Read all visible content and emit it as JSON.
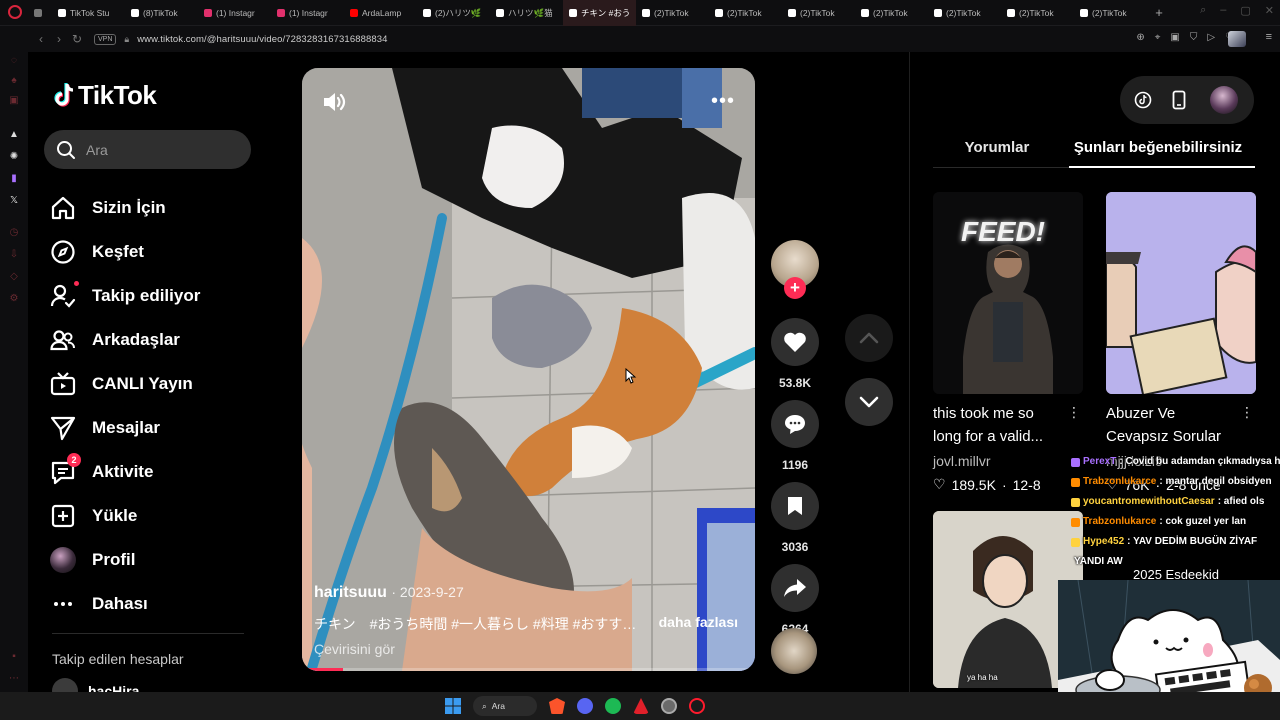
{
  "browser": {
    "tabs": [
      {
        "label": "",
        "color": "#777777",
        "workspace": true
      },
      {
        "label": "TikTok Stu",
        "color": "#ffffff"
      },
      {
        "label": "(8)TikTok",
        "color": "#ffffff"
      },
      {
        "label": "(1) Instagr",
        "color": "#e1306c"
      },
      {
        "label": "(1) Instagr",
        "color": "#e1306c"
      },
      {
        "label": "ArdaLamp",
        "color": "#ff0000"
      },
      {
        "label": "(2)ハリツ🌿",
        "color": "#ffffff"
      },
      {
        "label": "ハリツ🌿猫",
        "color": "#ffffff"
      },
      {
        "label": "チキン #おうち時",
        "color": "#ffffff",
        "active": true
      },
      {
        "label": "(2)TikTok",
        "color": "#ffffff"
      },
      {
        "label": "(2)TikTok",
        "color": "#ffffff"
      },
      {
        "label": "(2)TikTok",
        "color": "#ffffff"
      },
      {
        "label": "(2)TikTok",
        "color": "#ffffff"
      },
      {
        "label": "(2)TikTok",
        "color": "#ffffff"
      },
      {
        "label": "(2)TikTok",
        "color": "#ffffff"
      },
      {
        "label": "(2)TikTok",
        "color": "#ffffff"
      }
    ],
    "url": "www.tiktok.com/@haritsuuu/video/7283283167316888834",
    "vpn_label": "VPN"
  },
  "tiktok": {
    "logo_text": "TikTok",
    "search_placeholder": "Ara",
    "nav": [
      {
        "label": "Sizin İçin",
        "icon": "home-icon"
      },
      {
        "label": "Keşfet",
        "icon": "compass-icon"
      },
      {
        "label": "Takip ediliyor",
        "icon": "following-icon"
      },
      {
        "label": "Arkadaşlar",
        "icon": "friends-icon"
      },
      {
        "label": "CANLI Yayın",
        "icon": "live-icon"
      },
      {
        "label": "Mesajlar",
        "icon": "messages-icon"
      },
      {
        "label": "Aktivite",
        "icon": "activity-icon",
        "badge": "2"
      },
      {
        "label": "Yükle",
        "icon": "upload-icon"
      },
      {
        "label": "Profil",
        "icon": "profile-avatar"
      },
      {
        "label": "Dahası",
        "icon": "more-icon"
      }
    ],
    "followed_title": "Takip edilen hesaplar",
    "followed_first": "hacHira"
  },
  "video": {
    "author": "haritsuuu",
    "date": "2023-9-27",
    "caption": "チキン　#おうち時間 #一人暮らし #料理 #おすす…",
    "more_label": "daha fazlası",
    "translate_label": "Çevirisini gör",
    "progress": 0.09,
    "likes": "53.8K",
    "comments": "1196",
    "saves": "3036",
    "shares": "6264"
  },
  "right": {
    "tab_comments": "Yorumlar",
    "tab_like": "Şunları beğenebilirsiniz",
    "cards": [
      {
        "title": "this took me so long for a valid...",
        "author": "jovl.millvr",
        "likes": "189.5K",
        "date": "12-8",
        "thumb_text": "FEED!"
      },
      {
        "title": "Abuzer Ve Cevapsız Sorular",
        "author": "mjjj.lolzi9",
        "likes": "76K",
        "date": "2-8 önce"
      }
    ],
    "card3_caption": "ya ha ha"
  },
  "stream_overlay": {
    "chat": [
      {
        "user": "PerexT",
        "user_color": "#a970ff",
        "msg": ": Covid bu adamdan çıkmadıysa hi"
      },
      {
        "user": "Trabzonlukarce",
        "user_color": "#ff8c00",
        "msg": ": mantar degil obsidyen"
      },
      {
        "user": "youcantromewithoutCaesar",
        "user_color": "#ffd23f",
        "msg": ": afied ols"
      },
      {
        "user": "Trabzonlukarce",
        "user_color": "#ff8c00",
        "msg": ": cok guzel yer lan"
      },
      {
        "user": "Hype452",
        "user_color": "#ffd23f",
        "msg": ": YAV DEDİM BUGÜN ZİYAF"
      },
      {
        "user": "",
        "user_color": "#ffffff",
        "msg": "YANDI AW"
      }
    ],
    "title": "2025 Esdeekid"
  },
  "taskbar": {
    "search_label": "Ara"
  }
}
